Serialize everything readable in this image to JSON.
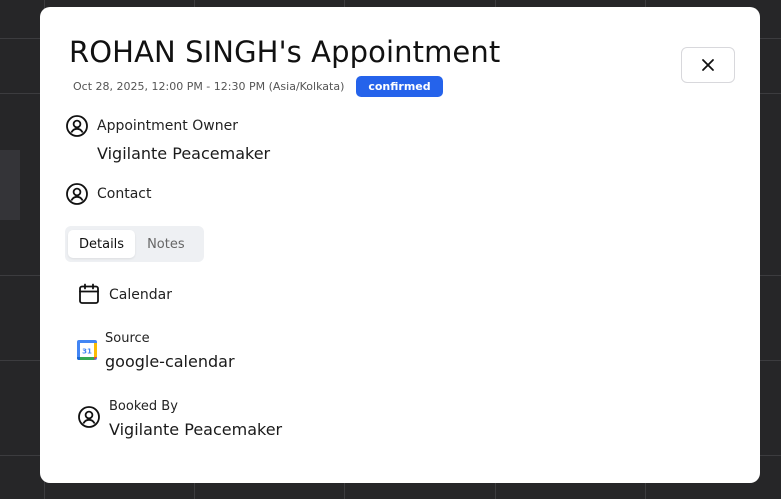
{
  "modal": {
    "title": "ROHAN SINGH's Appointment",
    "datetime": "Oct 28, 2025, 12:00 PM - 12:30 PM (Asia/Kolkata)",
    "status": "confirmed",
    "close_icon": "close-icon"
  },
  "owner": {
    "label": "Appointment Owner",
    "value": "Vigilante Peacemaker",
    "icon": "user-circle-icon"
  },
  "contact": {
    "label": "Contact",
    "icon": "user-circle-icon"
  },
  "tabs": [
    {
      "label": "Details",
      "active": true
    },
    {
      "label": "Notes",
      "active": false
    }
  ],
  "details": {
    "calendar": {
      "label": "Calendar",
      "icon": "calendar-icon"
    },
    "source": {
      "label": "Source",
      "value": "google-calendar",
      "icon": "google-calendar-icon"
    },
    "booked_by": {
      "label": "Booked By",
      "value": "Vigilante Peacemaker",
      "icon": "user-circle-icon"
    }
  },
  "colors": {
    "badge": "#2563eb",
    "backdrop": "#262628"
  }
}
